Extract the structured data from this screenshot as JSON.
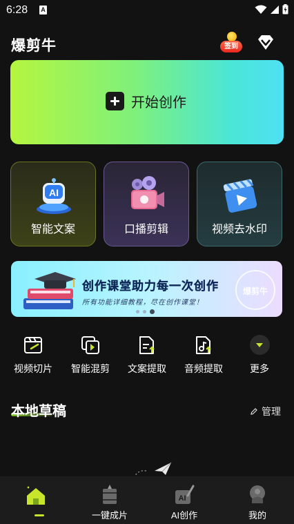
{
  "status_bar": {
    "time": "6:28",
    "sim_letter": "A"
  },
  "header": {
    "app_title": "爆剪牛",
    "checkin_label": "签到"
  },
  "hero": {
    "label": "开始创作"
  },
  "features": [
    {
      "label": "智能文案",
      "icon": "ai-robot-icon"
    },
    {
      "label": "口播剪辑",
      "icon": "camera-icon"
    },
    {
      "label": "视频去水印",
      "icon": "clapperboard-icon"
    }
  ],
  "banner": {
    "title": "创作课堂助力每一次创作",
    "subtitle": "所有功能详细教程，尽在创作课堂！",
    "stamp_text": "爆剪牛",
    "page_count": 3,
    "active_page": 3
  },
  "tools": [
    {
      "label": "视频切片",
      "icon": "video-slice-icon"
    },
    {
      "label": "智能混剪",
      "icon": "smart-mix-icon"
    },
    {
      "label": "文案提取",
      "icon": "text-extract-icon"
    },
    {
      "label": "音频提取",
      "icon": "audio-extract-icon"
    },
    {
      "label": "更多",
      "icon": "chevron-down-icon"
    }
  ],
  "drafts": {
    "title": "本地草稿",
    "manage_label": "管理"
  },
  "bottom_nav": [
    {
      "label": "",
      "icon": "home-icon",
      "active": true
    },
    {
      "label": "一键成片",
      "icon": "film-icon"
    },
    {
      "label": "AI创作",
      "icon": "ai-pen-icon"
    },
    {
      "label": "我的",
      "icon": "profile-icon"
    }
  ],
  "colors": {
    "accent": "#c7e62b",
    "background": "#121212",
    "nav_bg": "#1c1c1c"
  }
}
